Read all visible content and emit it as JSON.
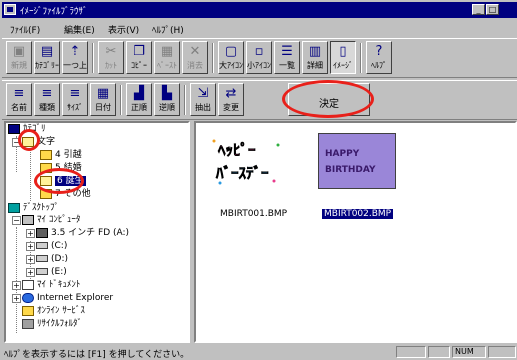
{
  "window": {
    "title": "ｲﾒｰｼﾞﾌｧｲﾙﾌﾞﾗｳｻﾞ",
    "min_glyph": "_",
    "max_glyph": "□"
  },
  "menu": [
    "ﾌｧｲﾙ(F)",
    "編集(E)",
    "表示(V)",
    "ﾍﾙﾌﾟ(H)"
  ],
  "toolbar1": [
    {
      "label": "新規",
      "icon": "new-icon",
      "glyph": "▣",
      "disabled": true
    },
    {
      "label": "ｶﾃｺﾞﾘｰ",
      "icon": "category-icon",
      "glyph": "▤",
      "disabled": false
    },
    {
      "label": "一つ上",
      "icon": "up-folder-icon",
      "glyph": "⇡",
      "disabled": false
    },
    {
      "label": "ｶｯﾄ",
      "icon": "cut-icon",
      "glyph": "✂",
      "disabled": true
    },
    {
      "label": "ｺﾋﾟｰ",
      "icon": "copy-icon",
      "glyph": "❐",
      "disabled": false
    },
    {
      "label": "ﾍﾟｰｽﾄ",
      "icon": "paste-icon",
      "glyph": "▦",
      "disabled": true
    },
    {
      "label": "消去",
      "icon": "delete-icon",
      "glyph": "✕",
      "disabled": true
    },
    {
      "label": "大ｱｲｺﾝ",
      "icon": "large-icons-icon",
      "glyph": "▢",
      "disabled": false
    },
    {
      "label": "小ｱｲｺﾝ",
      "icon": "small-icons-icon",
      "glyph": "▫",
      "disabled": false
    },
    {
      "label": "一覧",
      "icon": "list-icon",
      "glyph": "☰",
      "disabled": false
    },
    {
      "label": "詳細",
      "icon": "details-icon",
      "glyph": "▥",
      "disabled": false
    },
    {
      "label": "ｲﾒｰｼﾞ",
      "icon": "image-view-icon",
      "glyph": "▯",
      "disabled": false,
      "pressed": true
    },
    {
      "label": "ﾍﾙﾌﾟ",
      "icon": "help-icon",
      "glyph": "?",
      "disabled": false
    }
  ],
  "toolbar2": [
    {
      "label": "名前",
      "icon": "sort-name-icon",
      "glyph": "≡"
    },
    {
      "label": "種類",
      "icon": "sort-type-icon",
      "glyph": "≡"
    },
    {
      "label": "ｻｲｽﾞ",
      "icon": "sort-size-icon",
      "glyph": "≡"
    },
    {
      "label": "日付",
      "icon": "sort-date-icon",
      "glyph": "▦"
    },
    {
      "label": "正順",
      "icon": "ascending-icon",
      "glyph": "▟"
    },
    {
      "label": "逆順",
      "icon": "descending-icon",
      "glyph": "▙"
    },
    {
      "label": "抽出",
      "icon": "extract-icon",
      "glyph": "⇲"
    },
    {
      "label": "変更",
      "icon": "change-icon",
      "glyph": "⇄"
    }
  ],
  "decide_button": "決定",
  "tree": [
    {
      "label": "ｶﾃｺﾞﾘ",
      "icon": "category-root-icon"
    },
    {
      "label": "文字",
      "icon": "folder-open-icon"
    },
    {
      "label": "4 引越",
      "icon": "folder-icon"
    },
    {
      "label": "5 結婚",
      "icon": "folder-icon"
    },
    {
      "label": "6 誕生",
      "icon": "folder-open-icon",
      "selected": true
    },
    {
      "label": "7 その他",
      "icon": "folder-icon"
    },
    {
      "label": "ﾃﾞｽｸﾄｯﾌﾟ",
      "icon": "desktop-icon"
    },
    {
      "label": "ﾏｲ ｺﾝﾋﾟｭｰﾀ",
      "icon": "my-computer-icon"
    },
    {
      "label": "3.5 インチ FD (A:)",
      "icon": "floppy-icon"
    },
    {
      "label": "(C:)",
      "icon": "drive-c-icon"
    },
    {
      "label": "(D:)",
      "icon": "drive-d-icon"
    },
    {
      "label": "(E:)",
      "icon": "cdrom-icon"
    },
    {
      "label": "ﾏｲ ﾄﾞｷｭﾒﾝﾄ",
      "icon": "my-documents-icon"
    },
    {
      "label": "Internet Explorer",
      "icon": "ie-icon"
    },
    {
      "label": "ｵﾝﾗｲﾝ ｻｰﾋﾞｽ",
      "icon": "online-services-icon"
    },
    {
      "label": "ﾘｻｲｸﾙﾌｫﾙﾀﾞ",
      "icon": "recycle-bin-icon"
    }
  ],
  "files": [
    {
      "name": "MBIRT001.BMP",
      "selected": false,
      "art": "ﾍｯﾋﾟｰ ﾊﾞｰｽﾃﾞｰ"
    },
    {
      "name": "MBIRT002.BMP",
      "selected": true,
      "art": "HAPPY BIRTHDAY"
    }
  ],
  "status": {
    "text": "ﾍﾙﾌﾟを表示するには [F1] を押してください。",
    "num": "NUM"
  },
  "colors": {
    "titlebar": "#000080",
    "face": "#c0c0c0",
    "highlight_circle": "#e8201a",
    "page_bg": "#e6f0c8"
  }
}
